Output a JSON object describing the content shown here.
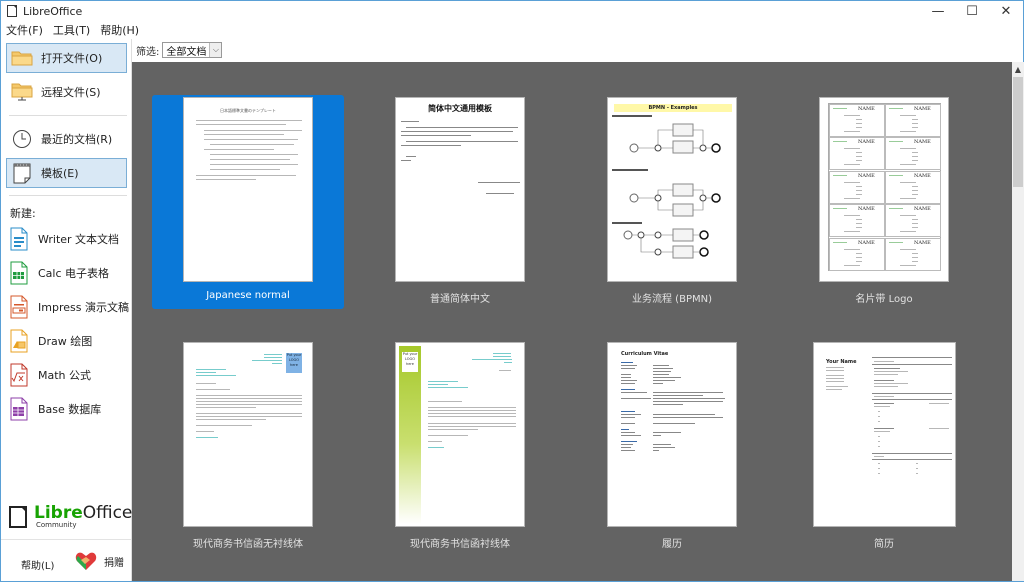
{
  "window": {
    "title": "LibreOffice",
    "controls": {
      "minimize": "—",
      "maximize": "☐",
      "close": "✕"
    }
  },
  "menubar": [
    "文件(F)",
    "工具(T)",
    "帮助(H)"
  ],
  "sidebar": {
    "nav": [
      {
        "label": "打开文件(O)",
        "icon": "folder-open-icon",
        "active": true
      },
      {
        "label": "远程文件(S)",
        "icon": "folder-remote-icon",
        "active": false
      },
      {
        "label": "最近的文档(R)",
        "icon": "clock-icon",
        "active": false
      },
      {
        "label": "模板(E)",
        "icon": "template-icon",
        "active": true
      }
    ],
    "new_heading": "新建:",
    "new_items": [
      {
        "label": "Writer 文本文档",
        "icon": "writer-icon",
        "color": "#2a8dc9"
      },
      {
        "label": "Calc 电子表格",
        "icon": "calc-icon",
        "color": "#1f9c3f"
      },
      {
        "label": "Impress 演示文稿",
        "icon": "impress-icon",
        "color": "#d5582b"
      },
      {
        "label": "Draw 绘图",
        "icon": "draw-icon",
        "color": "#e8a222"
      },
      {
        "label": "Math 公式",
        "icon": "math-icon",
        "color": "#c0392b"
      },
      {
        "label": "Base 数据库",
        "icon": "base-icon",
        "color": "#8e3fa8"
      }
    ],
    "brand": {
      "libre": "Libre",
      "office": "Office",
      "edition": "Community"
    },
    "help_label": "帮助(L)",
    "donate_label": "捐赠"
  },
  "filter": {
    "label": "筛选:",
    "selected": "全部文档"
  },
  "templates": [
    {
      "name": "Japanese normal",
      "selected": true,
      "doc_title": "日本語標準文書のテンプレート"
    },
    {
      "name": "普通简体中文",
      "selected": false,
      "doc_title": "简体中文通用模板"
    },
    {
      "name": "业务流程 (BPMN)",
      "selected": false,
      "doc_title": "BPMN - Examples"
    },
    {
      "name": "名片带 Logo",
      "selected": false,
      "doc_title": "NAME"
    },
    {
      "name": "现代商务书信函无衬线体",
      "selected": false,
      "doc_title": "Put your LOGO here"
    },
    {
      "name": "现代商务书信函衬线体",
      "selected": false,
      "doc_title": "Put your LOGO here"
    },
    {
      "name": "履历",
      "selected": false,
      "doc_title": "Curriculum Vitae"
    },
    {
      "name": "简历",
      "selected": false,
      "doc_title": "Your Name"
    }
  ],
  "colors": {
    "accent": "#0a78d7",
    "view_bg": "#636363",
    "sidebar_active": "#d9e8f5",
    "brand_green": "#18a303"
  }
}
